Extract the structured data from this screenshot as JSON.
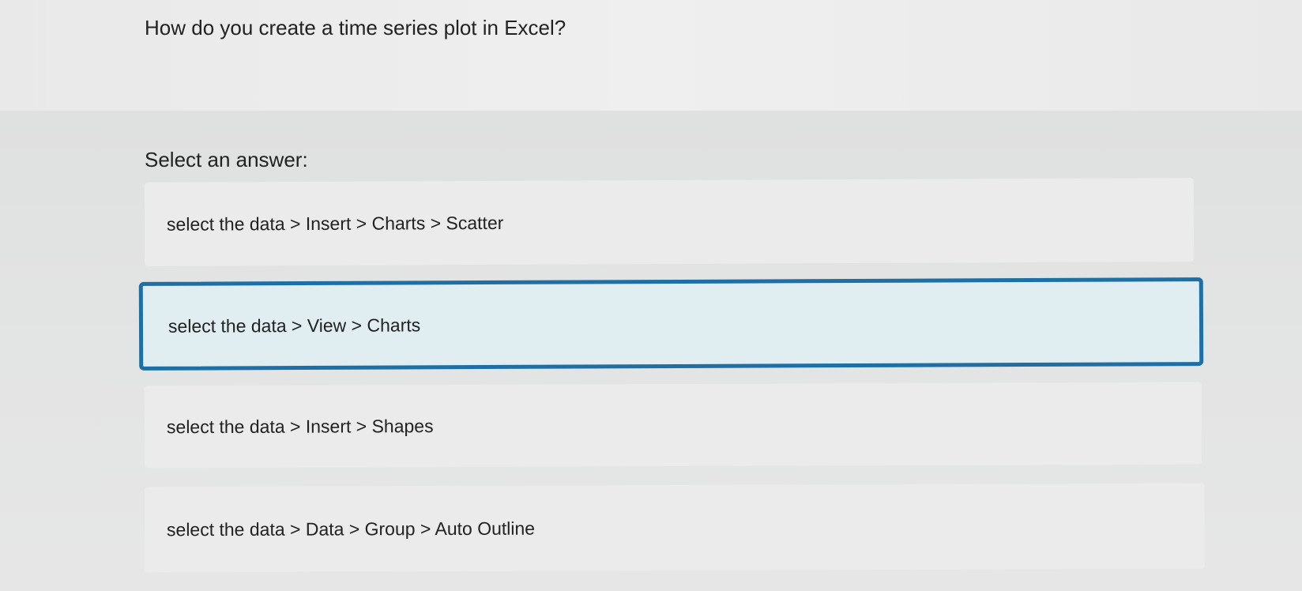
{
  "question": {
    "text": "How do you create a time series plot in Excel?"
  },
  "prompt": {
    "text": "Select an answer:"
  },
  "options": [
    {
      "label": "select the data > Insert > Charts > Scatter",
      "selected": false
    },
    {
      "label": "select the data > View > Charts",
      "selected": true
    },
    {
      "label": "select the data > Insert > Shapes",
      "selected": false
    },
    {
      "label": "select the data > Data > Group > Auto Outline",
      "selected": false
    }
  ],
  "colors": {
    "selected_border": "#1d6fa6",
    "selected_background": "#e1eef1",
    "option_background": "#ebebeb",
    "text": "#222222"
  }
}
